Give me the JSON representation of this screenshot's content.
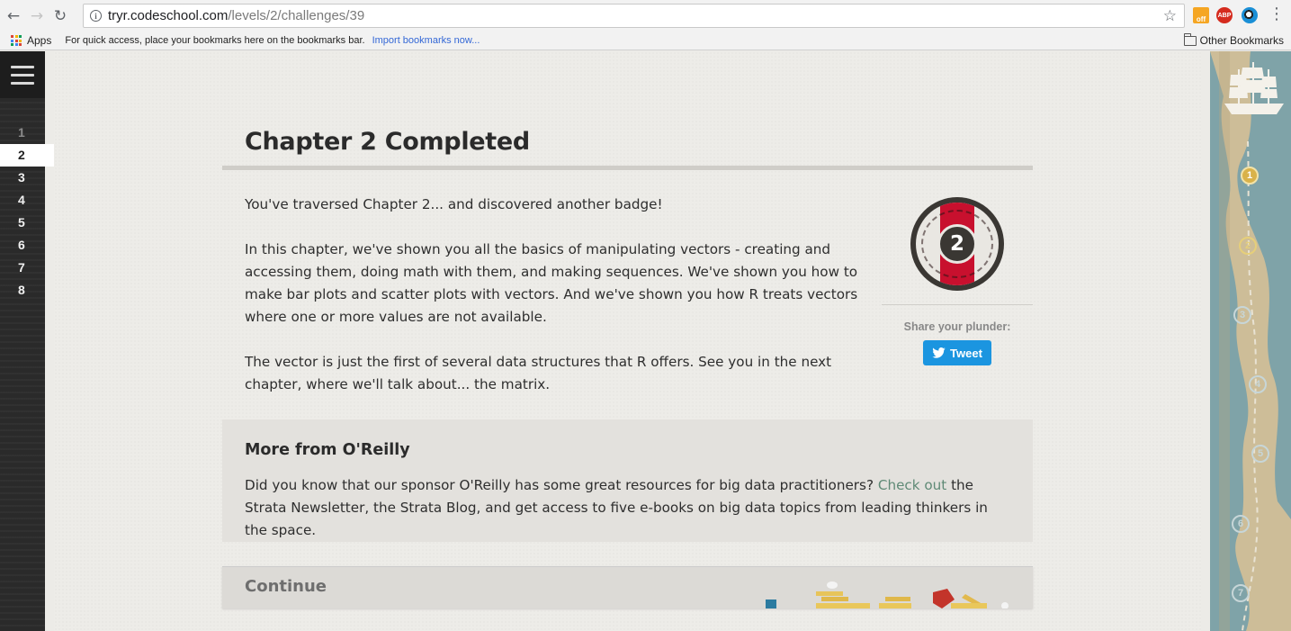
{
  "browser": {
    "url_host": "tryr.codeschool.com",
    "url_path": "/levels/2/challenges/39",
    "ext_off_label": "off",
    "ext_abp_label": "ABP",
    "bookmarks_bar": {
      "apps_label": "Apps",
      "hint": "For quick access, place your bookmarks here on the bookmarks bar.",
      "import_link": "Import bookmarks now...",
      "other_bookmarks": "Other Bookmarks"
    }
  },
  "sidebar": {
    "chapters": [
      {
        "label": "1",
        "state": "done"
      },
      {
        "label": "2",
        "state": "active"
      },
      {
        "label": "3",
        "state": "todo"
      },
      {
        "label": "4",
        "state": "todo"
      },
      {
        "label": "5",
        "state": "todo"
      },
      {
        "label": "6",
        "state": "todo"
      },
      {
        "label": "7",
        "state": "todo"
      },
      {
        "label": "8",
        "state": "todo"
      }
    ]
  },
  "main": {
    "title": "Chapter 2 Completed",
    "paragraph_1": "You've traversed Chapter 2... and discovered another badge!",
    "paragraph_2": "In this chapter, we've shown you all the basics of manipulating vectors - creating and accessing them, doing math with them, and making sequences. We've shown you how to make bar plots and scatter plots with vectors. And we've shown you how R treats vectors where one or more values are not available.",
    "paragraph_3": "The vector is just the first of several data structures that R offers. See you in the next chapter, where we'll talk about... the matrix.",
    "badge_number": "2",
    "share_label": "Share your plunder:",
    "tweet_label": "Tweet",
    "oreilly": {
      "title": "More from O'Reilly",
      "text_before": "Did you know that our sponsor O'Reilly has some great resources for big data practitioners? ",
      "link": "Check out",
      "text_after": " the Strata Newsletter, the Strata Blog, and get access to five e-books on big data topics from leading thinkers in the space."
    },
    "continue_label": "Continue"
  },
  "map": {
    "markers": [
      {
        "label": "1",
        "state": "done"
      },
      {
        "label": "2",
        "state": "current"
      },
      {
        "label": "3",
        "state": "todo"
      },
      {
        "label": "4",
        "state": "todo"
      },
      {
        "label": "5",
        "state": "todo"
      },
      {
        "label": "6",
        "state": "todo"
      },
      {
        "label": "7",
        "state": "todo"
      }
    ]
  },
  "colors": {
    "accent_red": "#c8102e",
    "twitter_blue": "#1b95e0",
    "link_green": "#5f8a76",
    "gold": "#d9b24a"
  }
}
